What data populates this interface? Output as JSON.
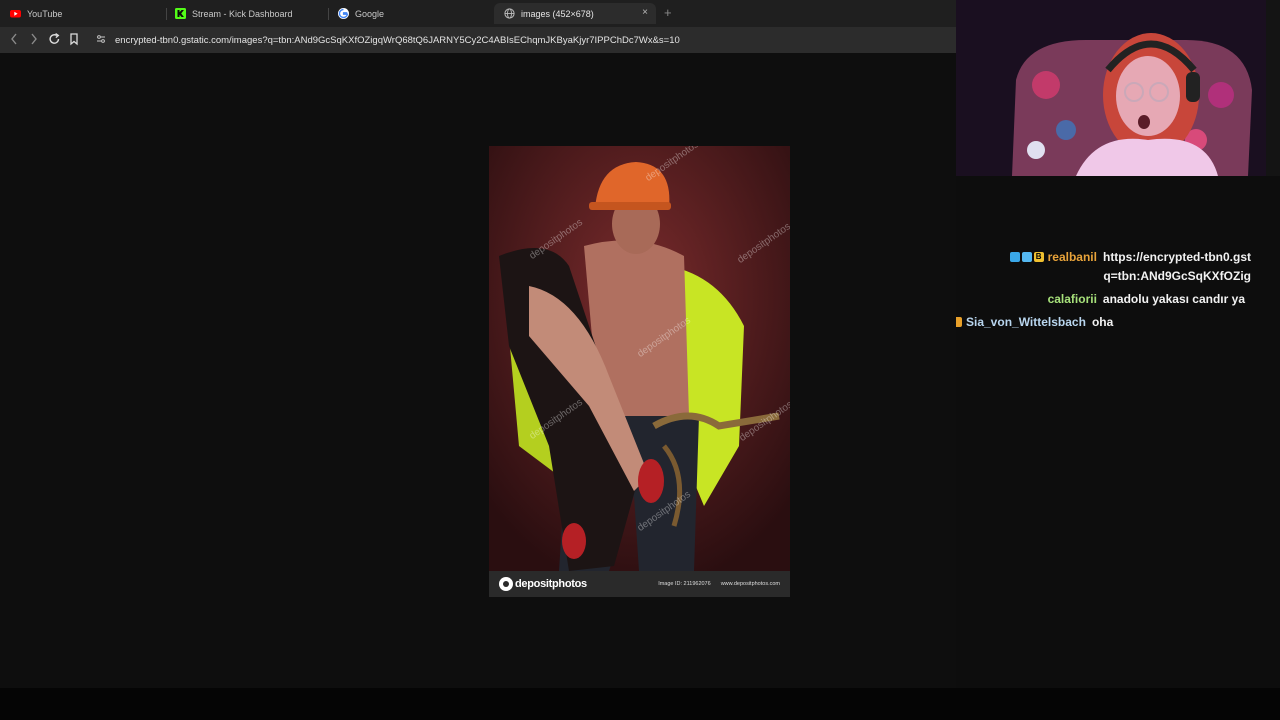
{
  "browser": {
    "tabs": [
      {
        "label": "YouTube",
        "favicon": "youtube-icon",
        "color": "#ff0000"
      },
      {
        "label": "Stream - Kick Dashboard",
        "favicon": "kick-icon",
        "color": "#53fc18"
      },
      {
        "label": "Google",
        "favicon": "google-icon",
        "color": "#4285f4"
      },
      {
        "label": "images (452×678)",
        "favicon": "globe-icon",
        "color": "#bbbbbb",
        "active": true
      }
    ],
    "close_glyph": "×",
    "new_tab_glyph": "+",
    "url": "encrypted-tbn0.gstatic.com/images?q=tbn:ANd9GcSqKXfOZigqWrQ68tQ6JARNY5Cy2C4ABIsEChqmJKByaKjyr7IPPChDc7Wx&s=10"
  },
  "image": {
    "logo_text": "depositphotos",
    "image_id": "Image ID: 211962076",
    "site": "www.depositphotos.com",
    "watermark": "depositphotos"
  },
  "chat": {
    "messages": [
      {
        "user": "realbanil",
        "user_color": "#e8a33a",
        "text": "https://encrypted-tbn0.gst",
        "text2": "q=tbn:ANd9GcSqKXfOZig"
      },
      {
        "user": "calafiorii",
        "user_color": "#a6e07a",
        "text": "anadolu yakası candır ya"
      },
      {
        "user": "Sia_von_Wittelsbach",
        "user_color": "#b9d6ef",
        "text": "oha"
      }
    ]
  }
}
